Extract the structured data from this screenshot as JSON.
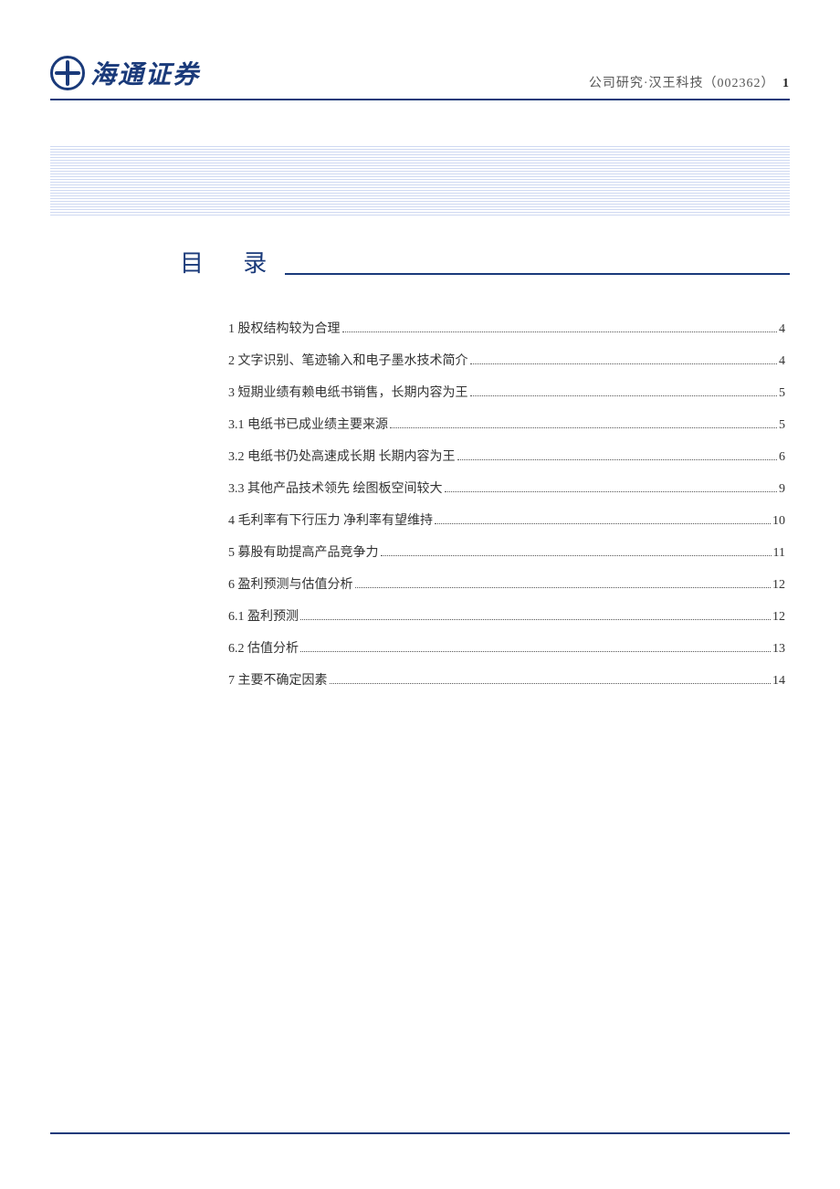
{
  "header": {
    "company": "海通证券",
    "breadcrumb": "公司研究·汉王科技（002362）",
    "page_number": "1"
  },
  "toc_title": "目 录",
  "toc": [
    {
      "label": "1 股权结构较为合理",
      "page": "4"
    },
    {
      "label": "2 文字识别、笔迹输入和电子墨水技术简介",
      "page": "4"
    },
    {
      "label": "3 短期业绩有赖电纸书销售，长期内容为王",
      "page": "5"
    },
    {
      "label": "3.1 电纸书已成业绩主要来源",
      "page": "5"
    },
    {
      "label": "3.2 电纸书仍处高速成长期 长期内容为王",
      "page": "6"
    },
    {
      "label": "3.3 其他产品技术领先  绘图板空间较大",
      "page": "9"
    },
    {
      "label": "4 毛利率有下行压力  净利率有望维持",
      "page": "10"
    },
    {
      "label": "5 募股有助提高产品竞争力",
      "page": "11"
    },
    {
      "label": "6 盈利预测与估值分析",
      "page": "12"
    },
    {
      "label": "6.1 盈利预测",
      "page": "12"
    },
    {
      "label": "6.2 估值分析",
      "page": "13"
    },
    {
      "label": "7 主要不确定因素",
      "page": "14"
    }
  ]
}
